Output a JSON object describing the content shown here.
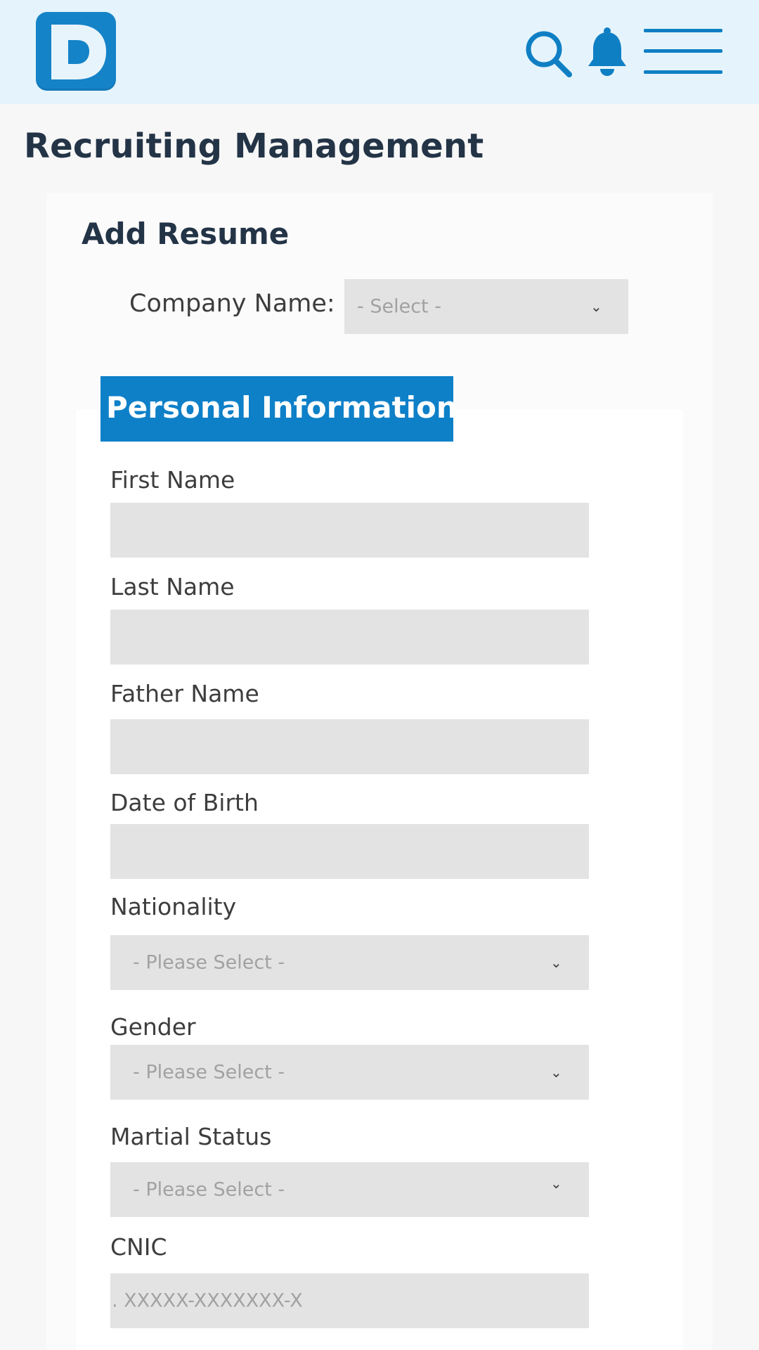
{
  "header": {
    "logo_letter": "D",
    "icons": [
      "search-icon",
      "bell-icon",
      "menu-icon"
    ],
    "accent_color": "#0e80c8"
  },
  "page": {
    "title": "Recruiting Management"
  },
  "form": {
    "title": "Add Resume",
    "company": {
      "label": "Company Name:",
      "selected": "- Select -"
    },
    "section_title": "Personal Information",
    "fields": {
      "first_name": {
        "label": "First Name",
        "value": ""
      },
      "last_name": {
        "label": "Last Name",
        "value": ""
      },
      "father_name": {
        "label": "Father Name",
        "value": ""
      },
      "dob": {
        "label": "Date of Birth",
        "value": ""
      },
      "nationality": {
        "label": "Nationality",
        "selected": "- Please Select -"
      },
      "gender": {
        "label": "Gender",
        "selected": "- Please Select -"
      },
      "marital": {
        "label": "Martial Status",
        "selected": "- Please Select -"
      },
      "cnic": {
        "label": "CNIC",
        "placeholder": ". XXXXX-XXXXXXX-X"
      }
    }
  }
}
